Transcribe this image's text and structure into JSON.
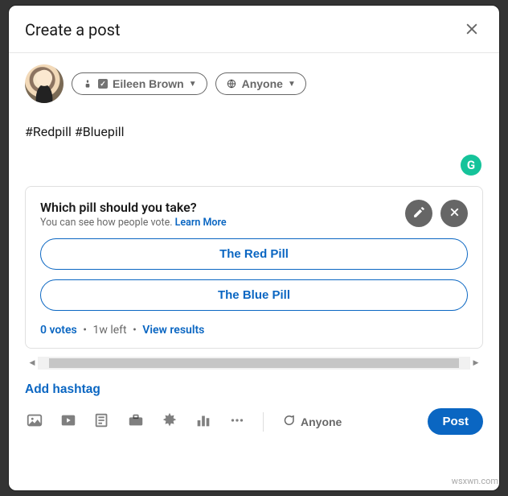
{
  "modal": {
    "title": "Create a post",
    "close_aria": "Close"
  },
  "author": {
    "name": "Eileen Brown",
    "visibility": "Anyone"
  },
  "post_text": "#Redpill #Bluepill",
  "grammarly_label": "G",
  "poll": {
    "question": "Which pill should you take?",
    "subtext": "You can see how people vote. ",
    "learn_more": "Learn More",
    "options": [
      "The Red Pill",
      "The Blue Pill"
    ],
    "votes_label": "0 votes",
    "time_left": "1w left",
    "view_results": "View results"
  },
  "add_hashtag": "Add hashtag",
  "comment_scope": "Anyone",
  "post_button": "Post",
  "icons": {
    "photo": "photo-icon",
    "video": "video-icon",
    "document": "document-icon",
    "job": "briefcase-icon",
    "celebrate": "starburst-icon",
    "poll": "bar-chart-icon",
    "more": "more-icon",
    "comment": "speech-bubble-icon",
    "edit": "pencil-icon",
    "remove": "x-icon",
    "person": "person-icon",
    "globe": "globe-icon",
    "caret": "chevron-down-icon",
    "close": "close-icon"
  },
  "watermark": "wsxwn.com"
}
